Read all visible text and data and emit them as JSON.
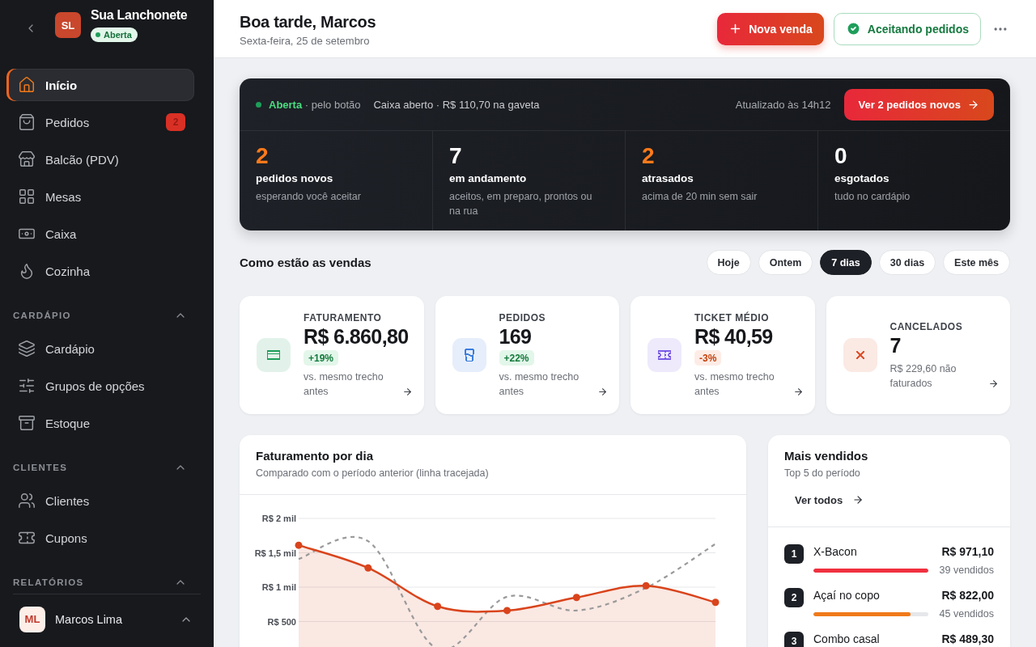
{
  "sidebar": {
    "store": {
      "initials": "SL",
      "name": "Sua Lanchonete",
      "status": "Aberta"
    },
    "nav": [
      {
        "label": "Início",
        "selected": true
      },
      {
        "label": "Pedidos",
        "selected": false,
        "badge": "2"
      },
      {
        "label": "Balcão (PDV)",
        "selected": false
      },
      {
        "label": "Mesas",
        "selected": false
      },
      {
        "label": "Caixa",
        "selected": false
      },
      {
        "label": "Cozinha",
        "selected": false
      }
    ],
    "sections": [
      {
        "title": "CARDÁPIO",
        "expanded": true,
        "items": [
          {
            "label": "Cardápio",
            "selected": false
          },
          {
            "label": "Grupos de opções",
            "selected": false
          },
          {
            "label": "Estoque",
            "selected": false
          }
        ]
      },
      {
        "title": "CLIENTES",
        "expanded": true,
        "items": [
          {
            "label": "Clientes",
            "selected": false
          },
          {
            "label": "Cupons",
            "selected": false
          }
        ]
      },
      {
        "title": "RELATÓRIOS",
        "expanded": true
      }
    ],
    "user": {
      "initials": "ML",
      "name": "Marcos Lima"
    }
  },
  "header": {
    "greeting": "Boa tarde, Marcos",
    "date": "Sexta-feira, 25 de setembro",
    "new_sale": "Nova venda",
    "accepting": "Aceitando pedidos"
  },
  "status_panel": {
    "status": "**Aberta** · pelo botão",
    "cash": "Caixa aberto · R$ 110,70 na gaveta",
    "updated": "Atualizado às 14h12",
    "cta": "Ver 2 pedidos novos",
    "stats": [
      {
        "value": "2",
        "label": "pedidos novos",
        "description": "esperando você aceitar",
        "alert": true
      },
      {
        "value": "7",
        "label": "em andamento",
        "description": "aceitos, em preparo, prontos ou na rua",
        "alert": false
      },
      {
        "value": "2",
        "label": "atrasados",
        "description": "acima de 20 min sem sair",
        "alert": true
      },
      {
        "value": "0",
        "label": "esgotados",
        "description": "tudo no cardápio",
        "alert": false
      }
    ]
  },
  "sales": {
    "title": "Como estão as vendas",
    "periods": [
      {
        "label": "Hoje",
        "selected": false
      },
      {
        "label": "Ontem",
        "selected": false
      },
      {
        "label": "7 dias",
        "selected": true
      },
      {
        "label": "30 dias",
        "selected": false
      },
      {
        "label": "Este mês",
        "selected": false
      }
    ],
    "kpis": [
      {
        "label": "FATURAMENTO",
        "value": "R$ 6.860,80",
        "change": "+19%",
        "positive": true,
        "note": "vs. mesmo trecho antes",
        "color": "#1e9e5a"
      },
      {
        "label": "PEDIDOS",
        "value": "169",
        "change": "+22%",
        "positive": true,
        "note": "vs. mesmo trecho antes",
        "color": "#3b7ddd"
      },
      {
        "label": "TICKET MÉDIO",
        "value": "R$ 40,59",
        "change": "-3%",
        "positive": false,
        "note": "vs. mesmo trecho antes",
        "color": "#7b5ce6"
      },
      {
        "label": "CANCELADOS",
        "value": "7",
        "note": "R$ 229,60 não faturados",
        "color": "#e0532f"
      }
    ]
  },
  "chart": {
    "title": "Faturamento por dia",
    "subtitle": "Comparado com o período anterior (linha tracejada)",
    "y_axis_labels": [
      "R$ 2 mil",
      "R$ 1,5 mil",
      "R$ 1 mil",
      "R$ 500"
    ]
  },
  "top_products": {
    "title": "Mais vendidos",
    "subtitle": "Top 5 do período",
    "link": "Ver todos",
    "items": [
      {
        "rank": "1",
        "name": "X-Bacon",
        "revenue": "R$ 971,10",
        "level": 1,
        "color": "#f0303f",
        "sold": "39 vendidos"
      },
      {
        "rank": "2",
        "name": "Açaí no copo",
        "revenue": "R$ 822,00",
        "level": 0.85,
        "color": "#f07a1a",
        "sold": "45 vendidos"
      },
      {
        "rank": "3",
        "name": "Combo casal",
        "revenue": "R$ 489,30"
      }
    ]
  }
}
